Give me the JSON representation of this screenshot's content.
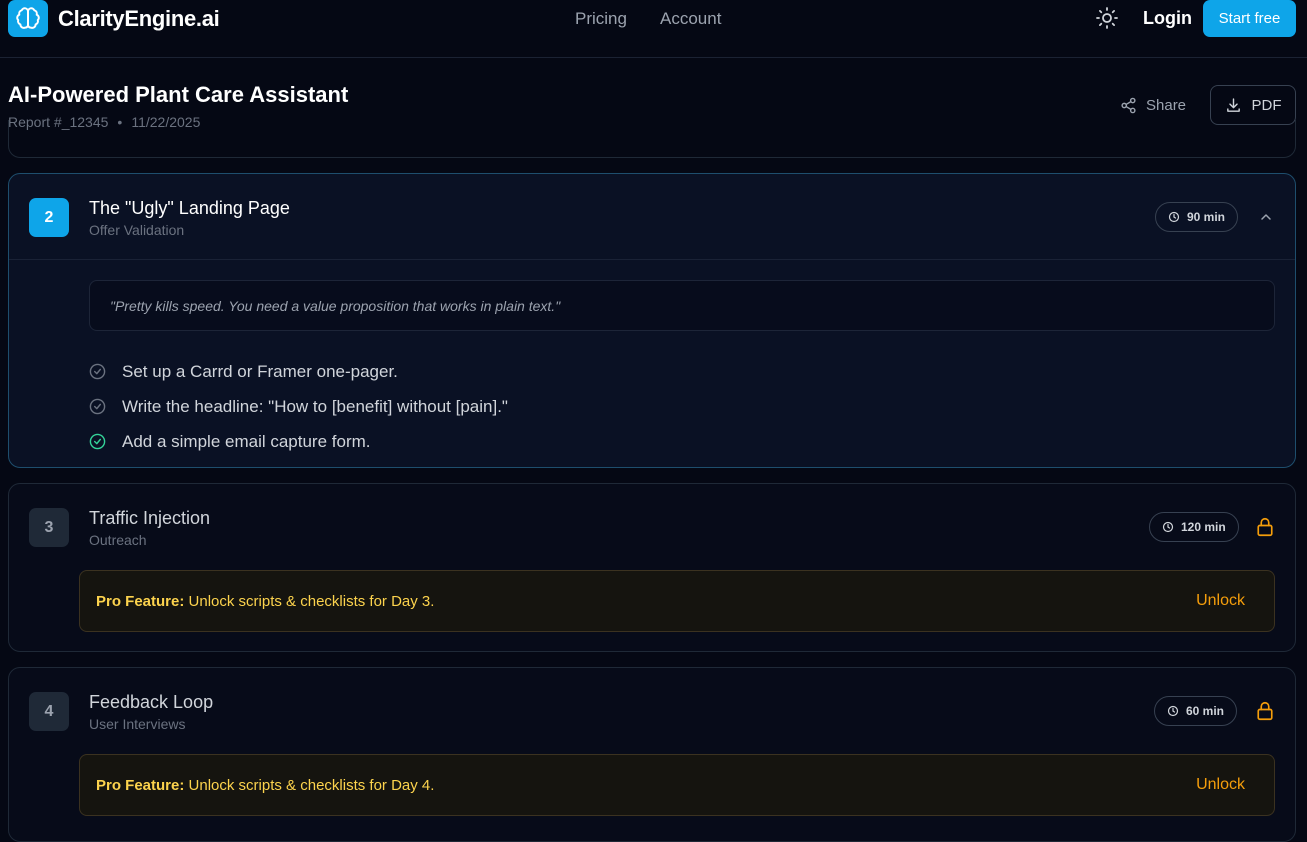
{
  "nav": {
    "brand": "ClarityEngine.ai",
    "links": [
      "Pricing",
      "Account"
    ],
    "login": "Login",
    "cta": "Start free"
  },
  "report": {
    "title": "AI-Powered Plant Care Assistant",
    "id": "Report #_12345",
    "date": "11/22/2025",
    "share": "Share",
    "pdf": "PDF"
  },
  "days": [
    {
      "number": "2",
      "title": "The \"Ugly\" Landing Page",
      "subtitle": "Offer Validation",
      "duration": "90 min",
      "expanded": true,
      "quote": "\"Pretty kills speed. You need a value proposition that works in plain text.\"",
      "tasks": [
        {
          "text": "Set up a Carrd or Framer one-pager.",
          "done": false
        },
        {
          "text": "Write the headline: \"How to [benefit] without [pain].\"",
          "done": false
        },
        {
          "text": "Add a simple email capture form.",
          "done": true
        }
      ]
    },
    {
      "number": "3",
      "title": "Traffic Injection",
      "subtitle": "Outreach",
      "duration": "120 min",
      "locked": true,
      "pro_label": "Pro Feature:",
      "pro_text": "Unlock scripts & checklists for Day 3.",
      "unlock": "Unlock"
    },
    {
      "number": "4",
      "title": "Feedback Loop",
      "subtitle": "User Interviews",
      "duration": "60 min",
      "locked": true,
      "pro_label": "Pro Feature:",
      "pro_text": "Unlock scripts & checklists for Day 4.",
      "unlock": "Unlock"
    }
  ],
  "colors": {
    "accent": "#0ea5e9",
    "background": "#050814",
    "pro": "#fcd34d",
    "done": "#34d399"
  },
  "icons": [
    "brain-icon",
    "sun-icon",
    "share-icon",
    "download-icon",
    "clock-icon",
    "chevron-up-icon",
    "lock-icon",
    "check-circle-icon"
  ]
}
